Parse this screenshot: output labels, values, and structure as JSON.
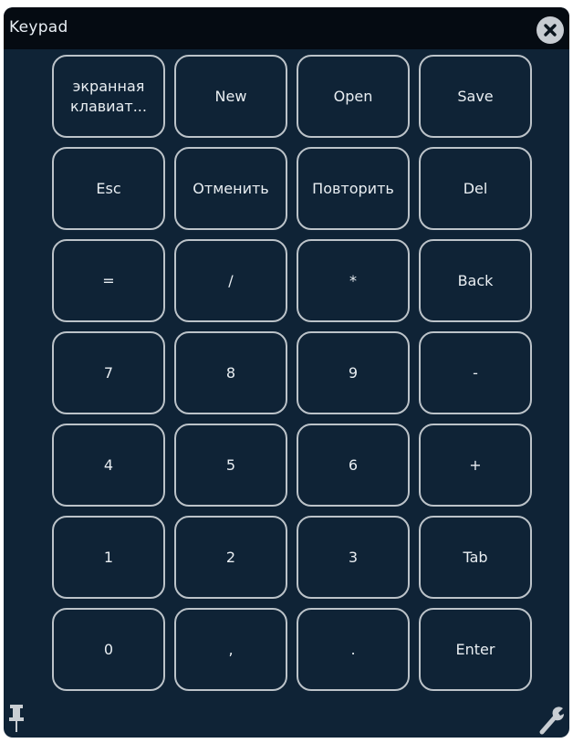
{
  "window": {
    "title": "Keypad",
    "close_icon": "close-icon",
    "pin_icon": "pin-icon",
    "settings_icon": "wrench-icon"
  },
  "colors": {
    "background": "#0f2336",
    "titlebar": "#050b12",
    "key_border": "#bcc3c9",
    "key_text": "#e9eef2"
  },
  "keys": [
    [
      "экранная\nклавиат...",
      "New",
      "Open",
      "Save"
    ],
    [
      "Esc",
      "Отменить",
      "Повторить",
      "Del"
    ],
    [
      "=",
      "/",
      "*",
      "Back"
    ],
    [
      "7",
      "8",
      "9",
      "-"
    ],
    [
      "4",
      "5",
      "6",
      "+"
    ],
    [
      "1",
      "2",
      "3",
      "Tab"
    ],
    [
      "0",
      ",",
      ".",
      "Enter"
    ]
  ]
}
